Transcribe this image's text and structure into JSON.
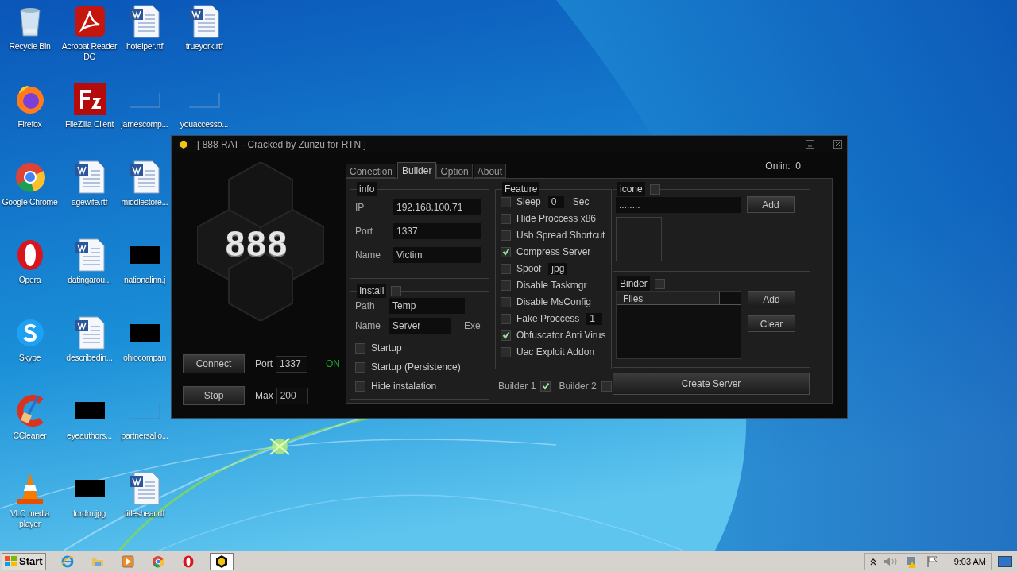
{
  "desktop_icons": [
    {
      "label": "Recycle Bin",
      "kind": "bin"
    },
    {
      "label": "Firefox",
      "kind": "fox"
    },
    {
      "label": "Google Chrome",
      "kind": "chrome"
    },
    {
      "label": "Opera",
      "kind": "opera"
    },
    {
      "label": "Skype",
      "kind": "skype"
    },
    {
      "label": "CCleaner",
      "kind": "cleaner"
    },
    {
      "label": "VLC media player",
      "kind": "cone"
    },
    {
      "label": "Acrobat Reader DC",
      "kind": "pdf"
    },
    {
      "label": "FileZilla Client",
      "kind": "ftp"
    },
    {
      "label": "agewife.rtf",
      "kind": "doc"
    },
    {
      "label": "datingarou...",
      "kind": "doc"
    },
    {
      "label": "describedin...",
      "kind": "doc"
    },
    {
      "label": "eyeauthors...",
      "kind": "dark"
    },
    {
      "label": "fordm.jpg",
      "kind": "dark"
    },
    {
      "label": "hotelper.rtf",
      "kind": "doc"
    },
    {
      "label": "jamescomp...",
      "kind": "blank"
    },
    {
      "label": "middlestore...",
      "kind": "doc"
    },
    {
      "label": "nationalinn.j",
      "kind": "dark"
    },
    {
      "label": "ohiocompan",
      "kind": "dark"
    },
    {
      "label": "partnersallo...",
      "kind": "blank"
    },
    {
      "label": "titleshear.rtf",
      "kind": "doc"
    },
    {
      "label": "trueyork.rtf",
      "kind": "doc"
    },
    {
      "label": "youaccesso...",
      "kind": "blank"
    }
  ],
  "window": {
    "title": "[ 888 RAT - Cracked by Zunzu for RTN ]",
    "logo_text": "888",
    "connect_button": "Connect",
    "stop_button": "Stop",
    "port_label": "Port",
    "port_value": "1337",
    "status": "ON",
    "max_label": "Max",
    "max_value": "200",
    "tabs": [
      {
        "label": "Conection",
        "selected": false
      },
      {
        "label": "Builder",
        "selected": true
      },
      {
        "label": "Option",
        "selected": false
      },
      {
        "label": "About",
        "selected": false
      }
    ],
    "online": "Onlin:  0",
    "info": {
      "title": "info",
      "fields": [
        {
          "label": "IP",
          "value": "192.168.100.71"
        },
        {
          "label": "Port",
          "value": "1337"
        },
        {
          "label": "Name",
          "value": "Victim"
        }
      ]
    },
    "install": {
      "title": "Install",
      "checked": false,
      "path_label": "Path",
      "path_value": "Temp",
      "name_label": "Name",
      "name_value": "Server",
      "extension": "Exe",
      "options": [
        {
          "label": "Startup",
          "checked": false
        },
        {
          "label": "Startup (Persistence)",
          "checked": false
        },
        {
          "label": "Hide instalation",
          "checked": false
        }
      ]
    },
    "feature": {
      "title": "Feature",
      "options": [
        {
          "label": "Sleep",
          "checked": false,
          "value": "0",
          "unit": "Sec"
        },
        {
          "label": "Hide Proccess x86",
          "checked": false
        },
        {
          "label": "Usb Spread Shortcut",
          "checked": false
        },
        {
          "label": "Compress Server",
          "checked": true
        },
        {
          "label": "Spoof",
          "checked": false,
          "value": "jpg"
        },
        {
          "label": "Disable Taskmgr",
          "checked": false
        },
        {
          "label": "Disable MsConfig",
          "checked": false
        },
        {
          "label": "Fake Proccess",
          "checked": false,
          "value": "1"
        },
        {
          "label": "Obfuscator Anti Virus",
          "checked": true
        },
        {
          "label": "Uac Exploit Addon",
          "checked": false
        }
      ]
    },
    "builders": [
      {
        "label": "Builder 1",
        "checked": true
      },
      {
        "label": "Builder 2",
        "checked": false
      }
    ],
    "icone": {
      "title": "icone",
      "checked": false,
      "path": "........",
      "add_button": "Add"
    },
    "binder": {
      "title": "Binder",
      "checked": false,
      "column": "Files",
      "add_button": "Add",
      "clear_button": "Clear"
    },
    "create_button": "Create Server"
  },
  "taskbar": {
    "start": "Start",
    "apps": [
      {
        "kind": "ie",
        "selected": false
      },
      {
        "kind": "folder",
        "selected": false
      },
      {
        "kind": "player",
        "selected": false
      },
      {
        "kind": "chrome",
        "selected": false
      },
      {
        "kind": "opera",
        "selected": false
      },
      {
        "kind": "rat",
        "selected": true
      }
    ],
    "clock": "9:03 AM"
  }
}
